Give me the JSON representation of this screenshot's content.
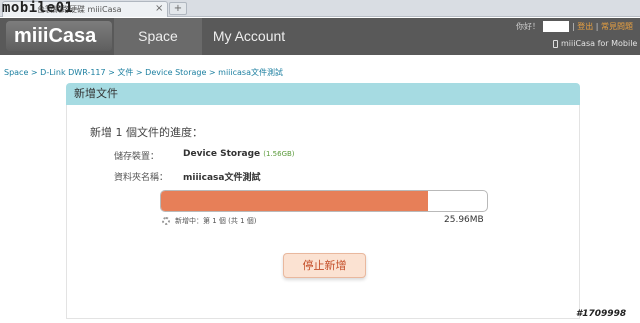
{
  "browser": {
    "tab_title": "台製網路硬碟 miiiCasa",
    "close_glyph": "×",
    "new_tab_glyph": "+"
  },
  "watermark": {
    "logo": "mobile01",
    "post_id": "#1709998"
  },
  "header": {
    "logo_text": "miiiCasa",
    "nav": [
      {
        "label": "Space",
        "active": true
      },
      {
        "label": "My Account",
        "active": false
      }
    ],
    "greeting": "你好！",
    "logout": "登出",
    "faq": "常見問題",
    "mobile_link": "miiiCasa for Mobile"
  },
  "breadcrumb": "Space > D-Link DWR-117 > 文件 > Device Storage > miiicasa文件測試",
  "panel": {
    "title": "新增文件",
    "progress_title": "新增 1 個文件的進度：",
    "storage_label": "儲存裝置：",
    "storage_value": "Device Storage",
    "storage_size": "(1.56GB)",
    "folder_label": "資料夾名稱：",
    "folder_value": "miiicasa文件測試",
    "progress_percent": 82,
    "status": "新增中：第 1 個 (共 1 個)",
    "size": "25.96MB",
    "stop_button": "停止新增"
  },
  "colors": {
    "header_bg": "#595959",
    "panel_title_bg": "#a6dbe2",
    "progress_fill": "#e77f58",
    "link": "#1c7fa0"
  }
}
